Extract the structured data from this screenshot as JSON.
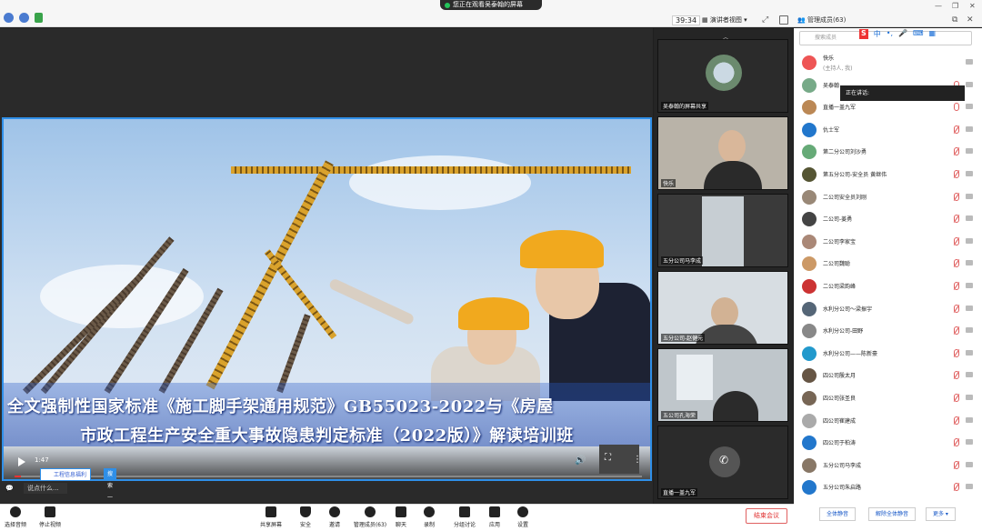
{
  "window": {
    "share_notice": "您正在观看吴泰翰的屏幕",
    "timer": "39:34",
    "view_mode": "演讲者视图",
    "panel_title": "管理成员(63)"
  },
  "slide": {
    "caption_line1": "全文强制性国家标准《施工脚手架通用规范》GB55023-2022与《房屋",
    "caption_line2": "市政工程生产安全重大事故隐患判定标准（2022版）》解读培训班",
    "play_time": "1:47",
    "reply_text": "工程信息福利",
    "reply_button": "搜索一下"
  },
  "chat": {
    "placeholder": "说点什么..."
  },
  "thumbnails": [
    {
      "label": "吴泰翰的屏幕共享"
    },
    {
      "label": "快乐"
    },
    {
      "label": "五分公司马李成"
    },
    {
      "label": "五分公司-赵健元"
    },
    {
      "label": "五公司孔海荣"
    },
    {
      "label": "直播一盖九军"
    }
  ],
  "participants": {
    "search_placeholder": "搜索成员",
    "speaking_label": "正在讲话:",
    "items": [
      {
        "name": "快乐",
        "sub": "(主持人, 我)",
        "color": "#e55"
      },
      {
        "name": "吴泰翰",
        "sub": "",
        "color": "#7a8"
      },
      {
        "name": "直播一盖九军",
        "sub": "",
        "color": "#b85"
      },
      {
        "name": "仇士军",
        "sub": "",
        "color": "#27c"
      },
      {
        "name": "第二分公司刘沙勇",
        "sub": "",
        "color": "#6a7"
      },
      {
        "name": "第五分公司-安全员 黄继伟",
        "sub": "",
        "color": "#553"
      },
      {
        "name": "二公司安全员刘刚",
        "sub": "",
        "color": "#987"
      },
      {
        "name": "二公司-姜勇",
        "sub": "",
        "color": "#444"
      },
      {
        "name": "二公司李家宝",
        "sub": "",
        "color": "#a87"
      },
      {
        "name": "二公司魏聪",
        "sub": "",
        "color": "#c96"
      },
      {
        "name": "二公司梁韵峰",
        "sub": "",
        "color": "#c33"
      },
      {
        "name": "水利分公司～梁振宇",
        "sub": "",
        "color": "#567"
      },
      {
        "name": "水利分公司-田野",
        "sub": "",
        "color": "#888"
      },
      {
        "name": "水利分公司——陈新豪",
        "sub": "",
        "color": "#29c"
      },
      {
        "name": "四公司殷太月",
        "sub": "",
        "color": "#654"
      },
      {
        "name": "四公司张圣良",
        "sub": "",
        "color": "#765"
      },
      {
        "name": "四公司崔建成",
        "sub": "",
        "color": "#aaa"
      },
      {
        "name": "四公司于柏涛",
        "sub": "",
        "color": "#27c"
      },
      {
        "name": "五分公司马李成",
        "sub": "",
        "color": "#876"
      },
      {
        "name": "五分公司朱启路",
        "sub": "",
        "color": "#27c"
      }
    ],
    "footer": {
      "mute_all": "全体静音",
      "unmute_all": "解除全体静音",
      "more": "更多 ▾"
    }
  },
  "toolbar": {
    "audio": "选择音频",
    "video": "停止视频",
    "share": "共享屏幕",
    "security": "安全",
    "invite": "邀请",
    "members": "管理成员(63)",
    "chat": "聊天",
    "record": "录制",
    "breakout": "分组讨论",
    "apps": "应用",
    "settings": "设置",
    "end": "结束会议"
  }
}
